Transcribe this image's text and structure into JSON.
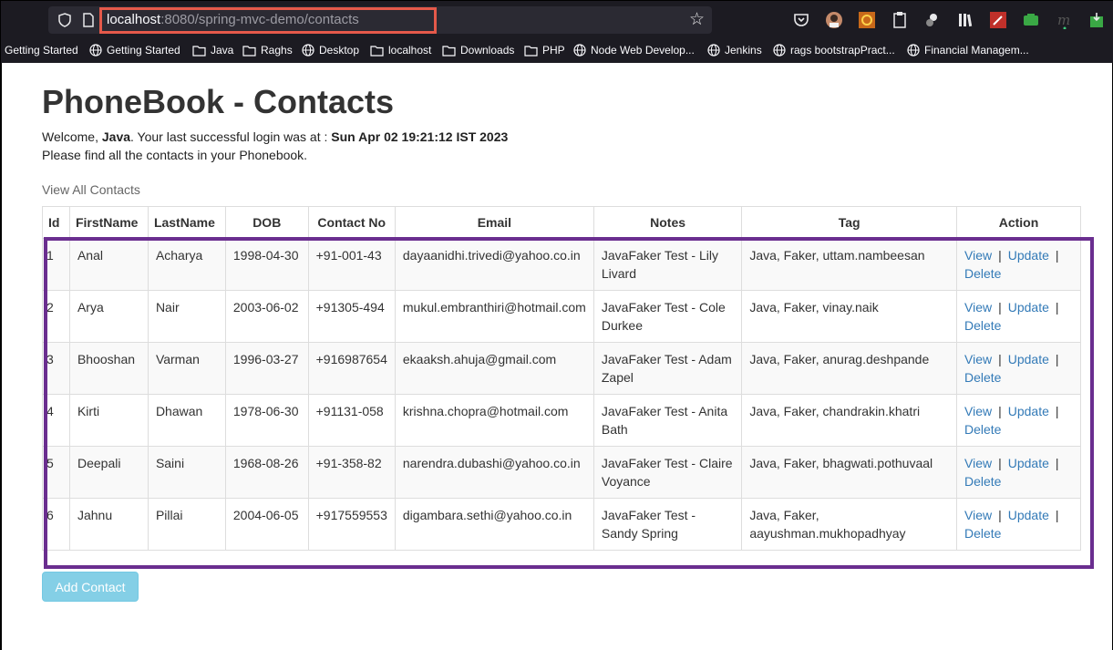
{
  "browser": {
    "url_host": "localhost",
    "url_path": ":8080/spring-mvc-demo/contacts",
    "bookmarks": [
      {
        "label": "Getting Started",
        "icon": "none"
      },
      {
        "label": "Getting Started",
        "icon": "globe-icon"
      },
      {
        "label": "Java",
        "icon": "folder-icon"
      },
      {
        "label": "Raghs",
        "icon": "folder-icon"
      },
      {
        "label": "Desktop",
        "icon": "globe-icon"
      },
      {
        "label": "localhost",
        "icon": "folder-icon"
      },
      {
        "label": "Downloads",
        "icon": "folder-icon"
      },
      {
        "label": "PHP",
        "icon": "folder-icon"
      },
      {
        "label": "Node Web Develop...",
        "icon": "globe-icon"
      },
      {
        "label": "Jenkins",
        "icon": "globe-icon"
      },
      {
        "label": "rags bootstrapPract...",
        "icon": "globe-icon"
      },
      {
        "label": "Financial Managem...",
        "icon": "globe-icon"
      }
    ]
  },
  "page": {
    "title": "PhoneBook - Contacts",
    "welcome_prefix": "Welcome, ",
    "user": "Java",
    "welcome_middle": ". Your last successful login was at : ",
    "last_login": "Sun Apr 02 19:21:12 IST 2023",
    "subtitle": "Please find all the contacts in your Phonebook.",
    "view_all": "View All Contacts",
    "add_button": "Add Contact"
  },
  "table": {
    "headers": [
      "Id",
      "FirstName",
      "LastName",
      "DOB",
      "Contact No",
      "Email",
      "Notes",
      "Tag",
      "Action"
    ],
    "action_view": "View",
    "action_update": "Update",
    "action_delete": "Delete",
    "action_sep": "|",
    "rows": [
      {
        "id": "1",
        "first": "Anal",
        "last": "Acharya",
        "dob": "1998-04-30",
        "phone": "+91-001-43",
        "email": "dayaanidhi.trivedi@yahoo.co.in",
        "notes": "JavaFaker Test - Lily Livard",
        "tag": "Java, Faker, uttam.nambeesan"
      },
      {
        "id": "2",
        "first": "Arya",
        "last": "Nair",
        "dob": "2003-06-02",
        "phone": "+91305-494",
        "email": "mukul.embranthiri@hotmail.com",
        "notes": "JavaFaker Test - Cole Durkee",
        "tag": "Java, Faker, vinay.naik"
      },
      {
        "id": "3",
        "first": "Bhooshan",
        "last": "Varman",
        "dob": "1996-03-27",
        "phone": "+916987654",
        "email": "ekaaksh.ahuja@gmail.com",
        "notes": "JavaFaker Test - Adam Zapel",
        "tag": "Java, Faker, anurag.deshpande"
      },
      {
        "id": "4",
        "first": "Kirti",
        "last": "Dhawan",
        "dob": "1978-06-30",
        "phone": "+91131-058",
        "email": "krishna.chopra@hotmail.com",
        "notes": "JavaFaker Test - Anita Bath",
        "tag": "Java, Faker, chandrakin.khatri"
      },
      {
        "id": "5",
        "first": "Deepali",
        "last": "Saini",
        "dob": "1968-08-26",
        "phone": "+91-358-82",
        "email": "narendra.dubashi@yahoo.co.in",
        "notes": "JavaFaker Test - Claire Voyance",
        "tag": "Java, Faker, bhagwati.pothuvaal"
      },
      {
        "id": "6",
        "first": "Jahnu",
        "last": "Pillai",
        "dob": "2004-06-05",
        "phone": "+917559553",
        "email": "digambara.sethi@yahoo.co.in",
        "notes": "JavaFaker Test - Sandy Spring",
        "tag": "Java, Faker, aayushman.mukhopadhyay"
      }
    ]
  },
  "colors": {
    "highlight_url": "#e5594a",
    "highlight_table": "#6a2e8f",
    "link": "#337ab7",
    "button": "#5bc0de"
  }
}
